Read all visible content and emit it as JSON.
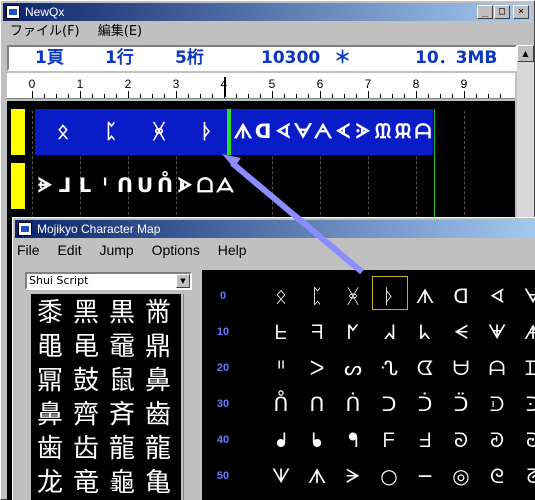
{
  "back_window": {
    "title": "NewQx",
    "caption_min": "_",
    "caption_max": "□",
    "caption_close": "×",
    "menu": [
      "ファイル(F)",
      "編集(E)"
    ],
    "status": {
      "page": "1頁",
      "line": "1行",
      "column": "5桁",
      "count": "10300",
      "mark": "＊",
      "size": "10．3MB"
    },
    "ruler_numbers": [
      "0",
      "1",
      "2",
      "3",
      "4",
      "5",
      "6",
      "7",
      "8",
      "9"
    ],
    "line1_chars": [
      "ᛟ",
      "ᛈ",
      "ᚸ",
      "ᚦ",
      "ᗑ",
      "ᗡ",
      "ᗏ",
      "ᗄ",
      "ᗅ",
      "ᗉ",
      "ᗈ",
      "ᙢ",
      "ᙕ",
      "ᗩ"
    ],
    "line2_chars": [
      "ᗓ",
      "ᒧ",
      "ᒪ",
      "ᑊ",
      "ᑎ",
      "ᑌ",
      "ᑍ",
      "ᗍ",
      "ᗝ",
      "ᗋ"
    ]
  },
  "front_window": {
    "title": "Mojikyo Character Map",
    "menu": [
      "File",
      "Edit",
      "Jump",
      "Options",
      "Help"
    ],
    "script_select": "Shui Script",
    "kanji": [
      [
        "黍",
        "黑",
        "黒",
        "黹"
      ],
      [
        "黽",
        "黾",
        "黿",
        "鼎"
      ],
      [
        "鼏",
        "鼓",
        "鼠",
        "鼻"
      ],
      [
        "鼻",
        "齊",
        "斉",
        "齒"
      ],
      [
        "歯",
        "齿",
        "龍",
        "龍"
      ],
      [
        "龙",
        "竜",
        "龜",
        "亀"
      ]
    ],
    "row_labels": [
      "0",
      "10",
      "20",
      "30",
      "40",
      "50"
    ],
    "shui_glyphs": [
      [
        "ᛟ",
        "ᛈ",
        "ᚸ",
        "ᚦ",
        "ᗑ",
        "ᗡ",
        "ᗏ",
        "ᗄ"
      ],
      [
        "ᖶ",
        "ᖷ",
        "ᖼ",
        "ᖽ",
        "ᖾ",
        "ᗕ",
        "ᗖ",
        "ᗗ"
      ],
      [
        "ᐦ",
        "ᐳ",
        "ᔕ",
        "ᔗ",
        "ᗧ",
        "ᗨ",
        "ᗩ",
        "ᗪ"
      ],
      [
        "ᑍ",
        "ᑎ",
        "ᑏ",
        "ᑐ",
        "ᑑ",
        "ᑒ",
        "ᑓ",
        "ᑔ"
      ],
      [
        "ᖱ",
        "ᖲ",
        "ᖳ",
        "ᖴ",
        "ᖵ",
        "ᘐ",
        "ᘑ",
        "ᘒ"
      ],
      [
        "ᗐ",
        "ᗑ",
        "ᗒ",
        "○",
        "─",
        "◎",
        "ᘓ",
        "ᘔ"
      ]
    ]
  },
  "colors": {
    "status_text": "#0a36c0",
    "selection": "#0a1cc8",
    "cursor": "#22e022",
    "gutter": "#ffff00",
    "arrow": "#8a8cff",
    "row_label": "#6878ff"
  }
}
